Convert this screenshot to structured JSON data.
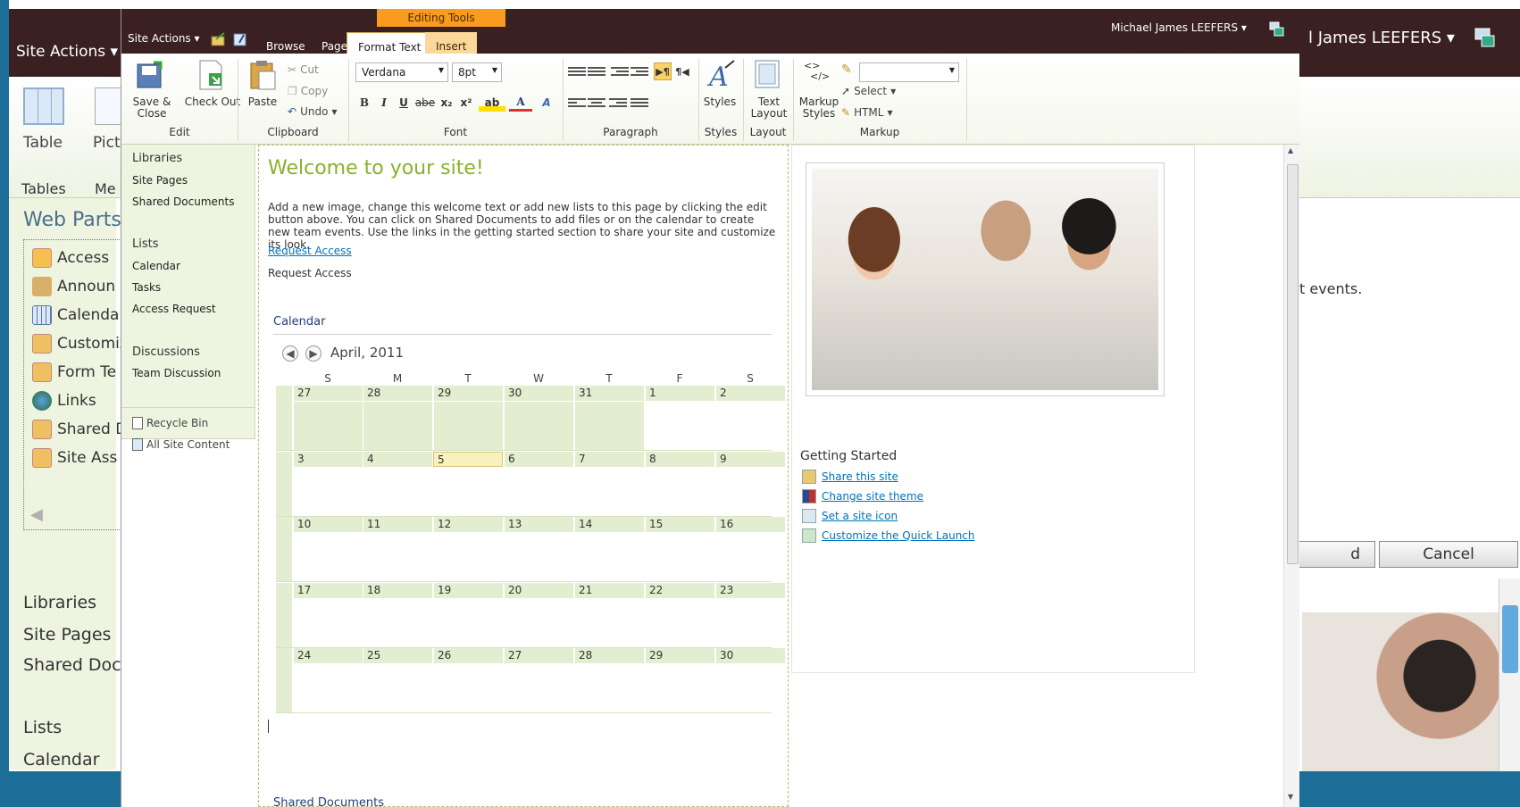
{
  "background_window": {
    "site_actions": "Site Actions ▾",
    "user": "l James LEEFERS ▾",
    "ribbon": {
      "table": "Table",
      "picture": "Pict",
      "group_tables": "Tables",
      "group_media": "Me"
    },
    "web_parts_title": "Web Parts",
    "web_parts": [
      "Access",
      "Announ",
      "Calendar",
      "Customiz",
      "Form Te",
      "Links",
      "Shared D",
      "Site Ass"
    ],
    "libraries": "Libraries",
    "site_pages": "Site Pages",
    "shared_docs": "Shared Doc",
    "lists": "Lists",
    "calendar": "Calendar",
    "events_text": "t events.",
    "ok_button": "d",
    "cancel_button": "Cancel"
  },
  "editor": {
    "site_actions": "Site Actions ▾",
    "contextual_group": "Editing Tools",
    "tabs": {
      "browse": "Browse",
      "page": "Page",
      "format_text": "Format Text",
      "insert": "Insert"
    },
    "user": "Michael James LEEFERS ▾",
    "ribbon": {
      "edit": {
        "save_close": "Save & Close",
        "check_out": "Check Out",
        "label": "Edit"
      },
      "clipboard": {
        "paste": "Paste",
        "cut": "Cut",
        "copy": "Copy",
        "undo": "Undo",
        "label": "Clipboard"
      },
      "font": {
        "family": "Verdana",
        "size": "8pt",
        "label": "Font",
        "bold": "B",
        "italic": "I",
        "underline": "U",
        "strike": "abe",
        "sub": "x₂",
        "sup": "x²"
      },
      "paragraph": {
        "label": "Paragraph"
      },
      "styles": {
        "styles": "Styles",
        "label": "Styles"
      },
      "layout": {
        "text_layout": "Text Layout",
        "label": "Layout"
      },
      "markup": {
        "markup_styles": "Markup Styles",
        "select": "Select",
        "html": "HTML",
        "label": "Markup"
      }
    },
    "nav": {
      "libraries": "Libraries",
      "site_pages": "Site Pages",
      "shared_documents": "Shared Documents",
      "lists": "Lists",
      "calendar": "Calendar",
      "tasks": "Tasks",
      "access_request": "Access Request",
      "discussions": "Discussions",
      "team_discussion": "Team Discussion",
      "recycle_bin": "Recycle Bin",
      "all_site_content": "All Site Content"
    },
    "content": {
      "welcome": "Welcome to your site!",
      "intro": "Add a new image, change this welcome text or add new lists to this page by clicking the edit button above. You can click on Shared Documents to add files or on the calendar to create new team events. Use the links in the getting started section to share your site and customize its look.",
      "request_access_link": "Request Access",
      "request_access_text": "Request Access",
      "calendar_title": "Calendar",
      "calendar_month": "April, 2011",
      "days_of_week": [
        "S",
        "M",
        "T",
        "W",
        "T",
        "F",
        "S"
      ],
      "weeks": [
        [
          "27",
          "28",
          "29",
          "30",
          "31",
          "1",
          "2"
        ],
        [
          "3",
          "4",
          "5",
          "6",
          "7",
          "8",
          "9"
        ],
        [
          "10",
          "11",
          "12",
          "13",
          "14",
          "15",
          "16"
        ],
        [
          "17",
          "18",
          "19",
          "20",
          "21",
          "22",
          "23"
        ],
        [
          "24",
          "25",
          "26",
          "27",
          "28",
          "29",
          "30"
        ]
      ],
      "shared_documents_title": "Shared Documents"
    },
    "getting_started": {
      "title": "Getting Started",
      "links": [
        "Share this site",
        "Change site theme",
        "Set a site icon",
        "Customize the Quick Launch"
      ]
    }
  },
  "colors": {
    "topbar": "#3a2020",
    "accent_orange": "#f89b1f",
    "welcome_green": "#8ab12c",
    "nav_bg": "#eef4e0",
    "calendar_green": "#e3edcf"
  }
}
